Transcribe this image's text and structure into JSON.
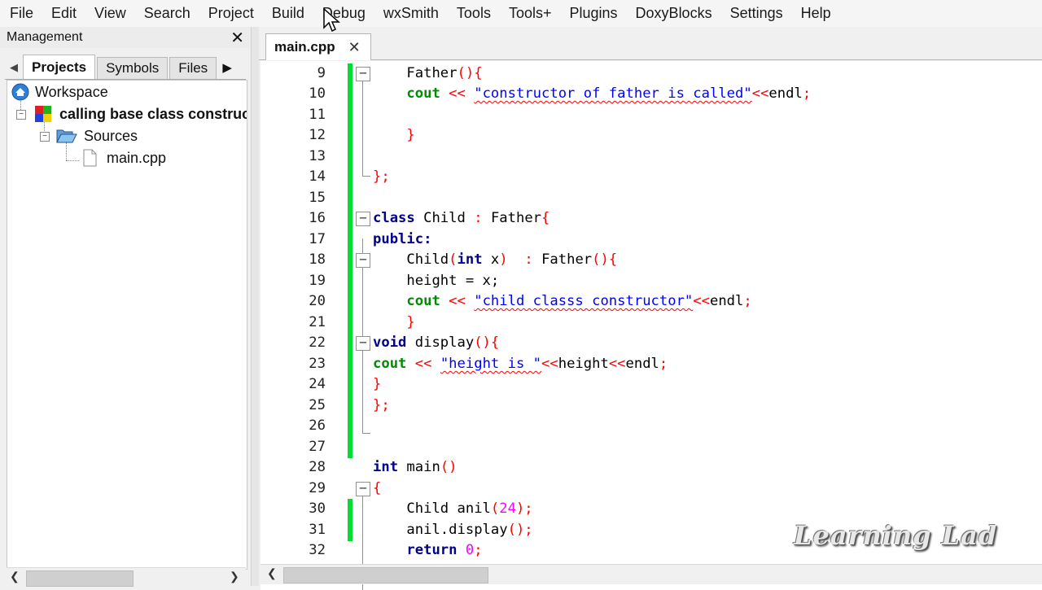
{
  "menu": [
    "File",
    "Edit",
    "View",
    "Search",
    "Project",
    "Build",
    "Debug",
    "wxSmith",
    "Tools",
    "Tools+",
    "Plugins",
    "DoxyBlocks",
    "Settings",
    "Help"
  ],
  "management": {
    "title": "Management",
    "close_glyph": "✕",
    "tabs": [
      "Projects",
      "Symbols",
      "Files"
    ],
    "active_tab": "Projects",
    "tree": {
      "workspace": "Workspace",
      "project": "calling base class constructo",
      "sources": "Sources",
      "file": "main.cpp"
    }
  },
  "editor": {
    "tab_label": "main.cpp",
    "tab_close": "✕",
    "lines": [
      {
        "n": "9"
      },
      {
        "n": "10"
      },
      {
        "n": "11"
      },
      {
        "n": "12"
      },
      {
        "n": "13"
      },
      {
        "n": "14"
      },
      {
        "n": "15"
      },
      {
        "n": "16"
      },
      {
        "n": "17"
      },
      {
        "n": "18"
      },
      {
        "n": "19"
      },
      {
        "n": "20"
      },
      {
        "n": "21"
      },
      {
        "n": "22"
      },
      {
        "n": "23"
      },
      {
        "n": "24"
      },
      {
        "n": "25"
      },
      {
        "n": "26"
      },
      {
        "n": "27"
      },
      {
        "n": "28"
      },
      {
        "n": "29"
      },
      {
        "n": "30"
      },
      {
        "n": "31"
      },
      {
        "n": "32"
      }
    ],
    "code": {
      "l9_ident": "Father",
      "l10_cout": "cout",
      "l10_str": "\"constructor of father is called\"",
      "l10_endl": "endl",
      "l16_kw": "class",
      "l16_name": "Child",
      "l16_base": "Father",
      "l17_kw": "public:",
      "l18_name": "Child",
      "l18_type": "int",
      "l18_param": "x",
      "l18_base": "Father",
      "l19_text": "height = x;",
      "l20_cout": "cout",
      "l20_str": "\"child classs constructor\"",
      "l20_endl": "endl",
      "l22_kw": "void",
      "l22_name": "display",
      "l23_cout": "cout",
      "l23_str": "\"height is \"",
      "l23_var": "height",
      "l23_endl": "endl",
      "l28_kw": "int",
      "l28_name": "main",
      "l30_text": "Child anil",
      "l30_num": "24",
      "l31_text": "anil.display",
      "l32_kw": "return",
      "l32_num": "0"
    }
  },
  "watermark": "Learning Lad",
  "colors": {
    "change_bar": "#00dd33",
    "keyword": "#00008b",
    "cout": "#008b00",
    "string": "#0000ff",
    "operator": "#ff0000",
    "number": "#ff00ff"
  }
}
